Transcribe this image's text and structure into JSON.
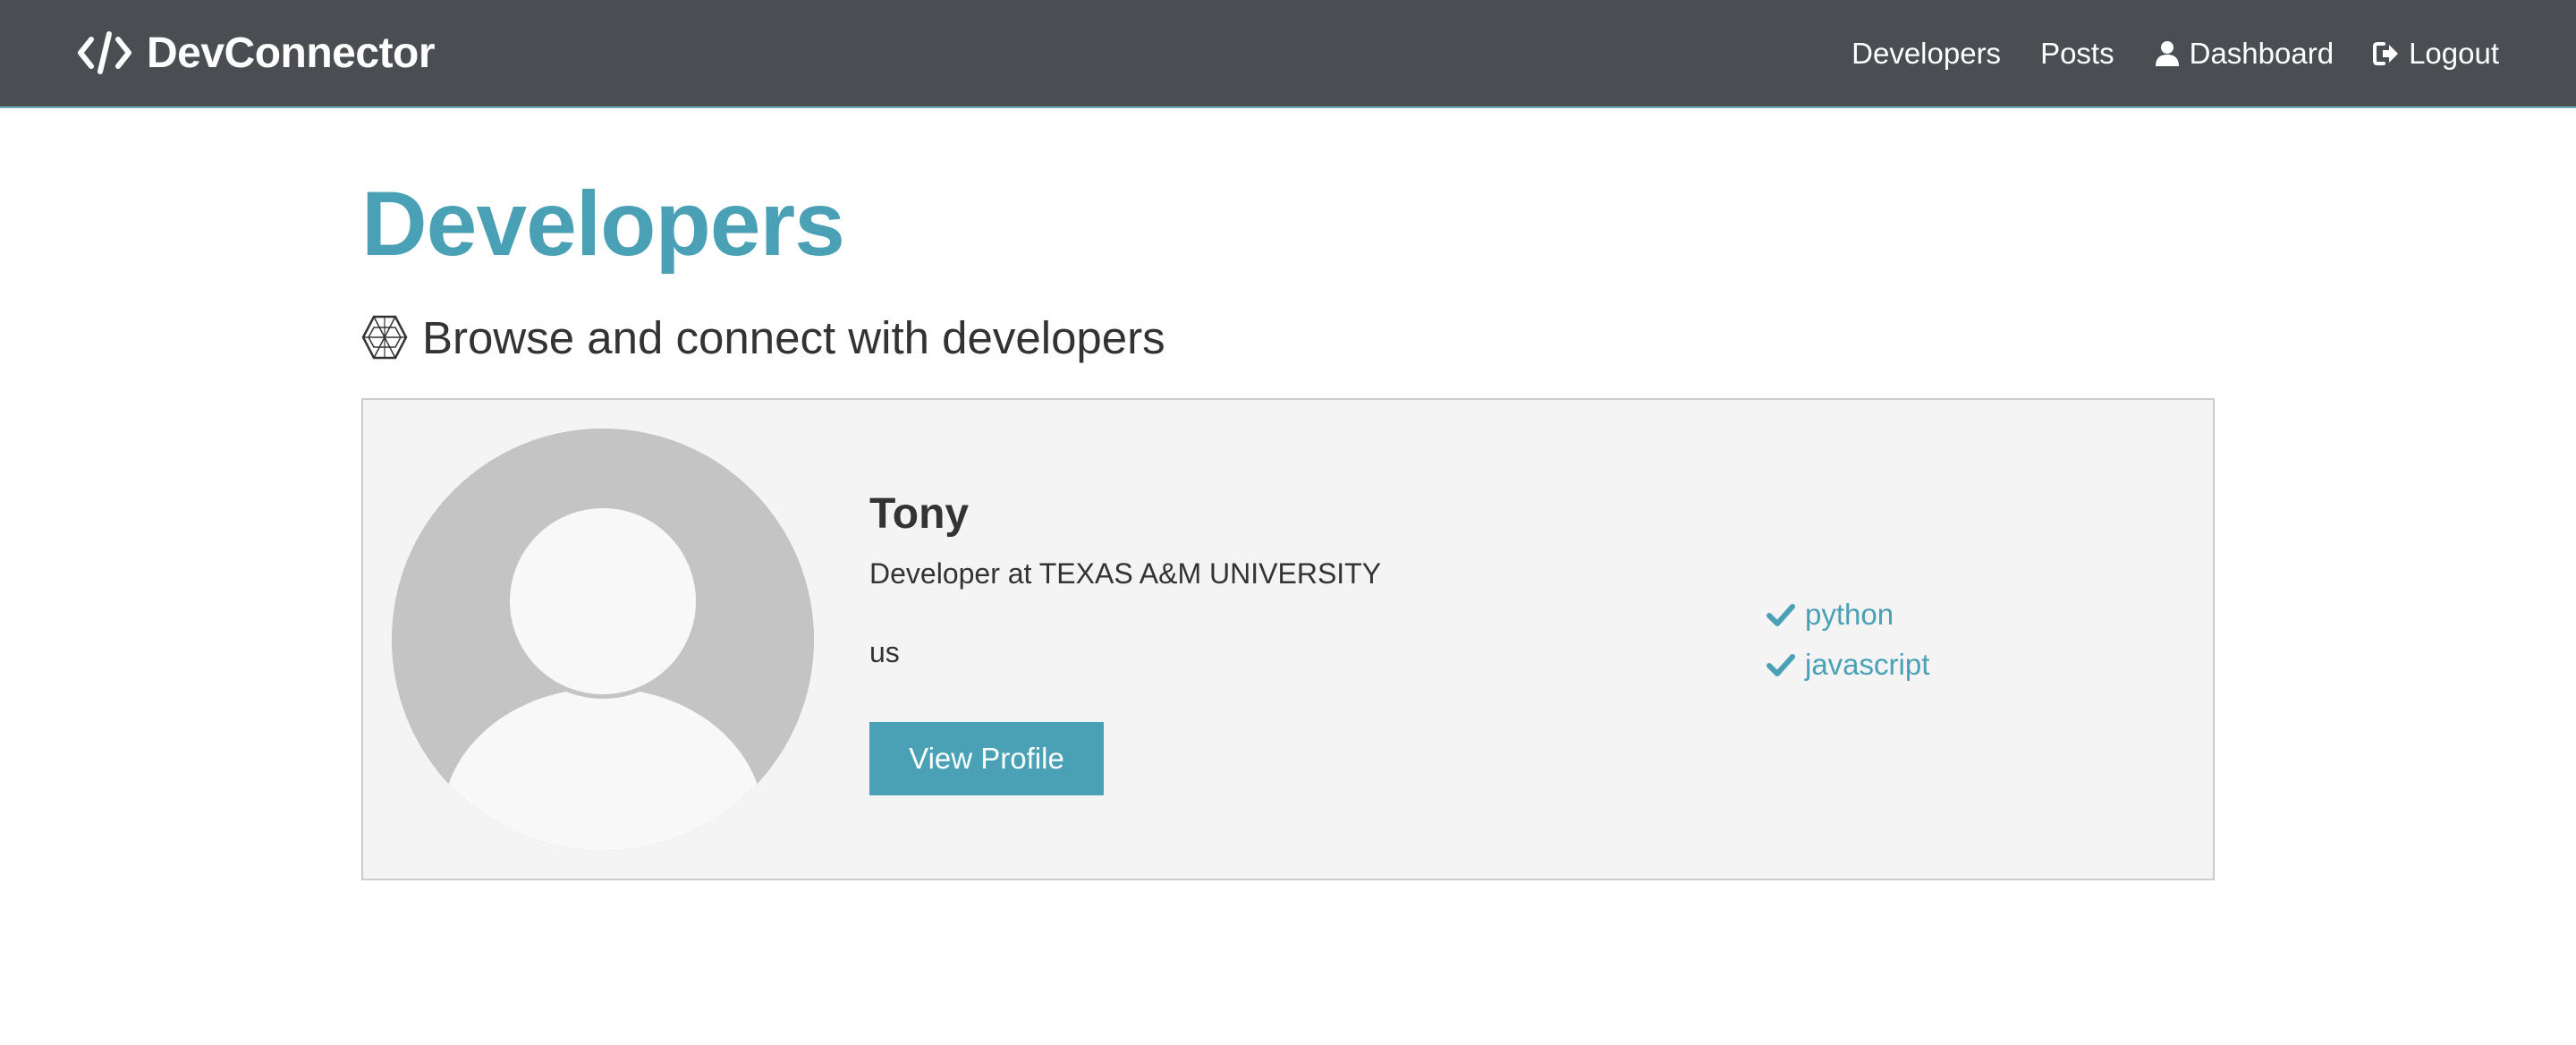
{
  "navbar": {
    "brand": "DevConnector",
    "links": [
      {
        "label": "Developers",
        "icon": ""
      },
      {
        "label": "Posts",
        "icon": ""
      },
      {
        "label": "Dashboard",
        "icon": "user-icon"
      },
      {
        "label": "Logout",
        "icon": "sign-out-icon"
      }
    ]
  },
  "page": {
    "title": "Developers",
    "lead": "Browse and connect with developers",
    "lead_icon": "connectdevelop-icon"
  },
  "profiles": [
    {
      "name": "Tony",
      "status": "Developer at TEXAS A&M UNIVERSITY",
      "location": "us",
      "button_label": "View Profile",
      "skills": [
        "python",
        "javascript"
      ]
    }
  ],
  "colors": {
    "accent": "#4aa1b6",
    "navbar": "#4a4e53",
    "card_bg": "#f4f4f4"
  }
}
